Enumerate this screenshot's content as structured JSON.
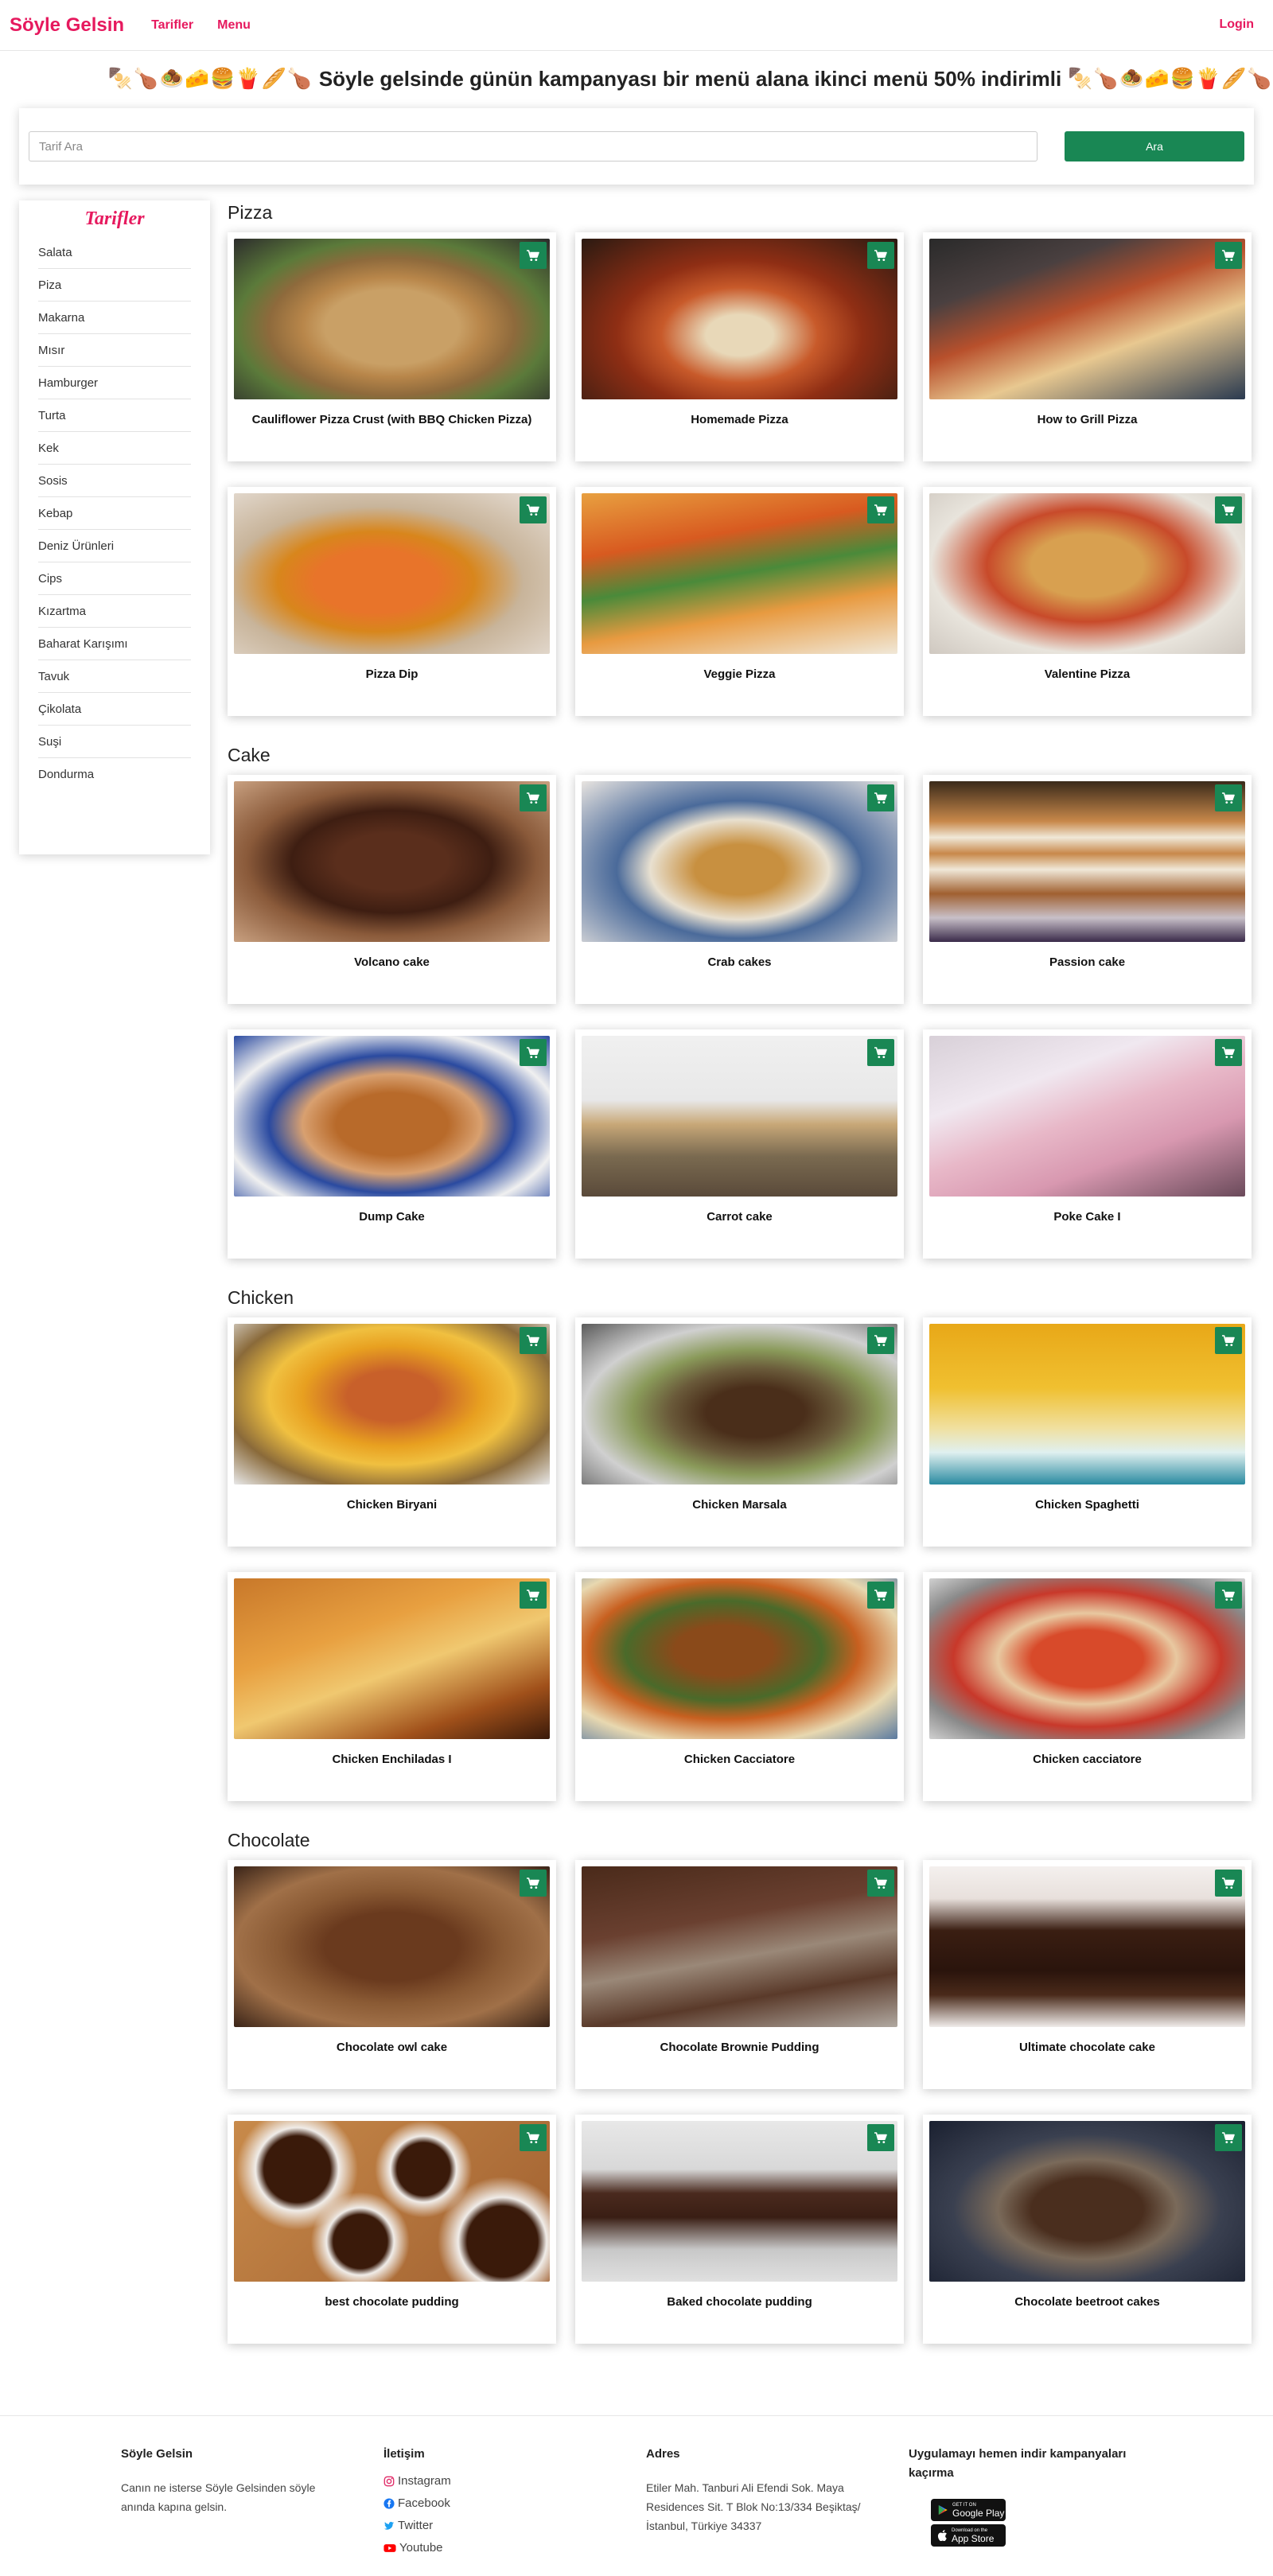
{
  "nav": {
    "brand": "Söyle Gelsin",
    "links": [
      "Tarifler",
      "Menu"
    ],
    "login": "Login"
  },
  "banner": {
    "emoji_left": "🍢🍗🧆🧀🍔🍟🥖🍗",
    "emoji_right": "🍢🍗🧆🧀🍔🍟🥖🍗",
    "text": "Söyle gelsinde günün kampanyası bir menü alana ikinci menü 50% indirimli"
  },
  "search": {
    "placeholder": "Tarif Ara",
    "value": "",
    "button": "Ara"
  },
  "sidebar": {
    "title": "Tarifler",
    "items": [
      "Salata",
      "Piza",
      "Makarna",
      "Mısır",
      "Hamburger",
      "Turta",
      "Kek",
      "Sosis",
      "Kebap",
      "Deniz Ürünleri",
      "Cips",
      "Kızartma",
      "Baharat Karışımı",
      "Tavuk",
      "Çikolata",
      "Suşi",
      "Dondurma"
    ]
  },
  "sections": [
    {
      "title": "Pizza",
      "cards": [
        {
          "title": "Cauliflower Pizza Crust (with BBQ Chicken Pizza)",
          "bg": "pizza1"
        },
        {
          "title": "Homemade Pizza",
          "bg": "pizza2"
        },
        {
          "title": "How to Grill Pizza",
          "bg": "pizza3"
        },
        {
          "title": "Pizza Dip",
          "bg": "pizza4"
        },
        {
          "title": "Veggie Pizza",
          "bg": "pizza5"
        },
        {
          "title": "Valentine Pizza",
          "bg": "pizza6"
        }
      ]
    },
    {
      "title": "Cake",
      "cards": [
        {
          "title": "Volcano cake",
          "bg": "cake1"
        },
        {
          "title": "Crab cakes",
          "bg": "cake2"
        },
        {
          "title": "Passion cake",
          "bg": "cake3"
        },
        {
          "title": "Dump Cake",
          "bg": "cake4"
        },
        {
          "title": "Carrot cake",
          "bg": "cake5"
        },
        {
          "title": "Poke Cake I",
          "bg": "cake6"
        }
      ]
    },
    {
      "title": "Chicken",
      "cards": [
        {
          "title": "Chicken Biryani",
          "bg": "chick1"
        },
        {
          "title": "Chicken Marsala",
          "bg": "chick2"
        },
        {
          "title": "Chicken Spaghetti",
          "bg": "chick3"
        },
        {
          "title": "Chicken Enchiladas I",
          "bg": "chick4"
        },
        {
          "title": "Chicken Cacciatore",
          "bg": "chick5"
        },
        {
          "title": "Chicken cacciatore",
          "bg": "chick6"
        }
      ]
    },
    {
      "title": "Chocolate",
      "cards": [
        {
          "title": "Chocolate owl cake",
          "bg": "choc1"
        },
        {
          "title": "Chocolate Brownie Pudding",
          "bg": "choc2"
        },
        {
          "title": "Ultimate chocolate cake",
          "bg": "choc3"
        },
        {
          "title": "best chocolate pudding",
          "bg": "choc4"
        },
        {
          "title": "Baked chocolate pudding",
          "bg": "choc5"
        },
        {
          "title": "Chocolate beetroot cakes",
          "bg": "choc6"
        }
      ]
    }
  ],
  "footer": {
    "col1": {
      "title": "Söyle Gelsin",
      "text": "Canın ne isterse Söyle Gelsinden söyle anında kapına gelsin."
    },
    "col2": {
      "title": "İletişim",
      "links": [
        "Instagram",
        "Facebook",
        "Twitter",
        "Youtube"
      ]
    },
    "col3": {
      "title": "Adres",
      "text": "Etiler Mah. Tanburi Ali Efendi Sok. Maya Residences Sit. T Blok No:13/334 Beşiktaş/İstanbul, Türkiye 34337"
    },
    "col4": {
      "title": "Uygulamayı hemen indir kampanyaları kaçırma",
      "google": {
        "small": "GET IT ON",
        "big": "Google Play"
      },
      "apple": {
        "small": "Download on the",
        "big": "App Store"
      }
    }
  },
  "colors": {
    "brand": "#e6195e",
    "success": "#198754"
  }
}
